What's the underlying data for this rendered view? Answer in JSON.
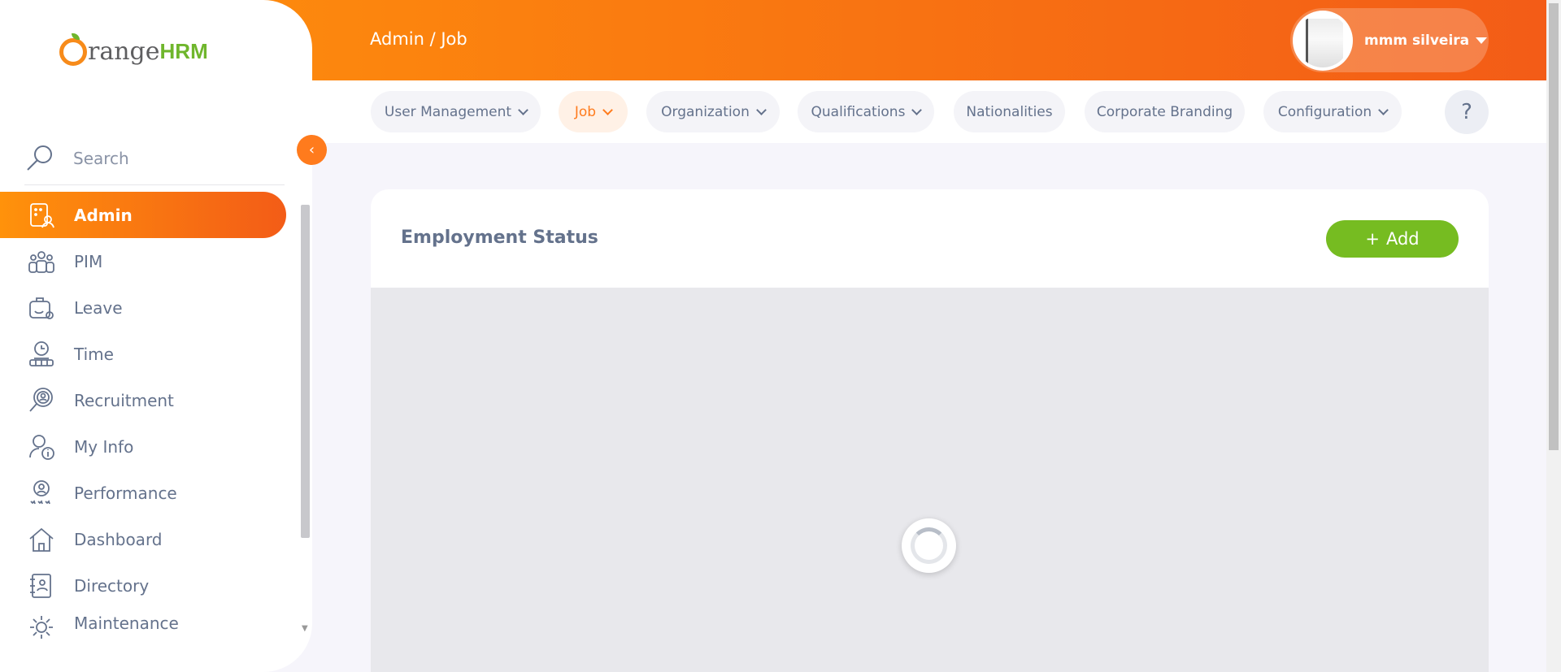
{
  "header": {
    "breadcrumb": "Admin / Job",
    "user_name": "mmm silveira"
  },
  "brand": {
    "logo_text": "OrangeHRM"
  },
  "sidebar": {
    "search_label": "Search",
    "items": [
      {
        "label": "Admin",
        "icon": "admin-icon",
        "active": true
      },
      {
        "label": "PIM",
        "icon": "pim-icon"
      },
      {
        "label": "Leave",
        "icon": "leave-icon"
      },
      {
        "label": "Time",
        "icon": "time-icon"
      },
      {
        "label": "Recruitment",
        "icon": "recruitment-icon"
      },
      {
        "label": "My Info",
        "icon": "my-info-icon"
      },
      {
        "label": "Performance",
        "icon": "performance-icon"
      },
      {
        "label": "Dashboard",
        "icon": "dashboard-icon"
      },
      {
        "label": "Directory",
        "icon": "directory-icon"
      },
      {
        "label": "Maintenance",
        "icon": "maintenance-icon"
      }
    ]
  },
  "subnav": {
    "tabs": [
      {
        "label": "User Management",
        "has_dropdown": true
      },
      {
        "label": "Job",
        "has_dropdown": true,
        "active": true
      },
      {
        "label": "Organization",
        "has_dropdown": true
      },
      {
        "label": "Qualifications",
        "has_dropdown": true
      },
      {
        "label": "Nationalities",
        "has_dropdown": false
      },
      {
        "label": "Corporate Branding",
        "has_dropdown": false
      },
      {
        "label": "Configuration",
        "has_dropdown": true
      }
    ],
    "help_label": "?"
  },
  "main": {
    "title": "Employment Status",
    "add_button": "Add",
    "add_icon": "+"
  },
  "colors": {
    "accent": "#ff7b1d",
    "header_gradient_start": "#ff920b",
    "header_gradient_end": "#f35c17",
    "add_button": "#76bc21"
  }
}
